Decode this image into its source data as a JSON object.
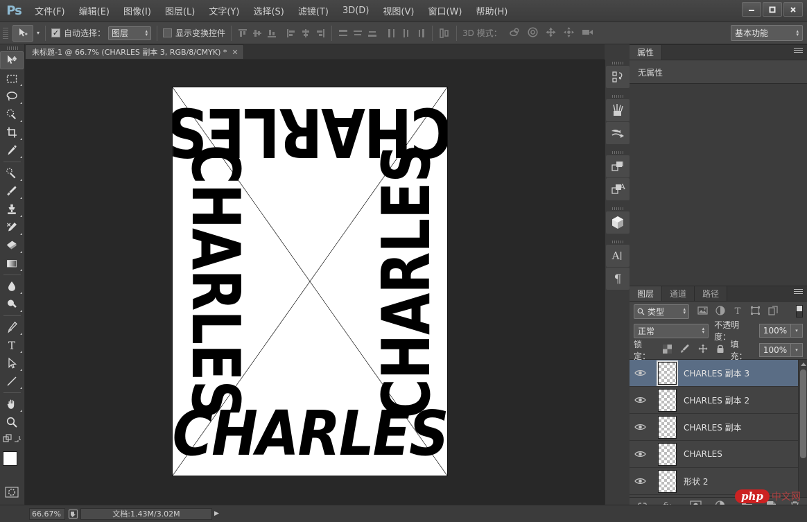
{
  "app": {
    "logo": "Ps",
    "window_controls": {
      "minimize": "—",
      "maximize": "▢",
      "close": "✕"
    }
  },
  "menubar": {
    "items": [
      {
        "label": "文件(F)",
        "name": "menu-file"
      },
      {
        "label": "编辑(E)",
        "name": "menu-edit"
      },
      {
        "label": "图像(I)",
        "name": "menu-image"
      },
      {
        "label": "图层(L)",
        "name": "menu-layer"
      },
      {
        "label": "文字(Y)",
        "name": "menu-type"
      },
      {
        "label": "选择(S)",
        "name": "menu-select"
      },
      {
        "label": "滤镜(T)",
        "name": "menu-filter"
      },
      {
        "label": "3D(D)",
        "name": "menu-3d"
      },
      {
        "label": "视图(V)",
        "name": "menu-view"
      },
      {
        "label": "窗口(W)",
        "name": "menu-window"
      },
      {
        "label": "帮助(H)",
        "name": "menu-help"
      }
    ]
  },
  "options_bar": {
    "auto_select_label": "自动选择：",
    "auto_select_checked": true,
    "auto_select_target": "图层",
    "show_transform_label": "显示变换控件",
    "show_transform_checked": false,
    "mode_3d_label": "3D 模式：",
    "workspace": "基本功能"
  },
  "document_tab": {
    "title": "未标题-1 @ 66.7% (CHARLES 副本 3, RGB/8/CMYK) *",
    "close": "✕"
  },
  "toolbar": {
    "tools": [
      {
        "name": "move-tool",
        "active": true
      },
      {
        "name": "rectangular-marquee-tool",
        "active": false
      },
      {
        "name": "lasso-tool",
        "active": false
      },
      {
        "name": "quick-selection-tool",
        "active": false
      },
      {
        "name": "crop-tool",
        "active": false
      },
      {
        "name": "eyedropper-tool",
        "active": false
      },
      {
        "name": "spot-healing-brush-tool",
        "active": false
      },
      {
        "name": "brush-tool",
        "active": false
      },
      {
        "name": "clone-stamp-tool",
        "active": false
      },
      {
        "name": "history-brush-tool",
        "active": false
      },
      {
        "name": "eraser-tool",
        "active": false
      },
      {
        "name": "gradient-tool",
        "active": false
      },
      {
        "name": "blur-tool",
        "active": false
      },
      {
        "name": "dodge-tool",
        "active": false
      },
      {
        "name": "pen-tool",
        "active": false
      },
      {
        "name": "horizontal-type-tool",
        "active": false
      },
      {
        "name": "path-selection-tool",
        "active": false
      },
      {
        "name": "line-tool",
        "active": false
      },
      {
        "name": "hand-tool",
        "active": false
      },
      {
        "name": "zoom-tool",
        "active": false
      }
    ],
    "foreground_color": "#ffffff",
    "background_color": "#b5008f"
  },
  "canvas": {
    "artwork_text": "CHARLES",
    "background_color": "#282828",
    "artboard_color": "#ffffff"
  },
  "icon_dock": {
    "buttons": [
      {
        "name": "history-panel-icon"
      },
      {
        "name": "brush-presets-panel-icon"
      },
      {
        "name": "clone-source-panel-icon"
      },
      {
        "name": "adjustments-panel-icon"
      },
      {
        "name": "styles-panel-icon"
      },
      {
        "name": "3d-panel-icon"
      },
      {
        "name": "character-panel-icon"
      },
      {
        "name": "paragraph-panel-icon"
      }
    ]
  },
  "properties_panel": {
    "tab": "属性",
    "empty_message": "无属性"
  },
  "layers_panel": {
    "tabs": [
      {
        "label": "图层",
        "active": true
      },
      {
        "label": "通道",
        "active": false
      },
      {
        "label": "路径",
        "active": false
      }
    ],
    "filter_type": "类型",
    "blend_mode": "正常",
    "opacity_label": "不透明度：",
    "opacity_value": "100%",
    "lock_label": "锁定：",
    "fill_label": "填充：",
    "fill_value": "100%",
    "layers": [
      {
        "name": "CHARLES 副本 3",
        "visible": true,
        "selected": true
      },
      {
        "name": "CHARLES 副本 2",
        "visible": true,
        "selected": false
      },
      {
        "name": "CHARLES 副本",
        "visible": true,
        "selected": false
      },
      {
        "name": "CHARLES",
        "visible": true,
        "selected": false
      },
      {
        "name": "形状 2",
        "visible": true,
        "selected": false
      },
      {
        "name": "",
        "visible": true,
        "selected": false
      }
    ],
    "footer_buttons": [
      {
        "name": "link-layers-button"
      },
      {
        "name": "layer-style-button"
      },
      {
        "name": "layer-mask-button"
      },
      {
        "name": "adjustment-layer-button"
      },
      {
        "name": "new-group-button"
      },
      {
        "name": "new-layer-button"
      },
      {
        "name": "delete-layer-button"
      }
    ]
  },
  "status_bar": {
    "zoom": "66.67%",
    "doc_info": "文档:1.43M/3.02M",
    "arrow": "▶"
  },
  "watermark": {
    "badge": "php",
    "text": "中文网"
  }
}
